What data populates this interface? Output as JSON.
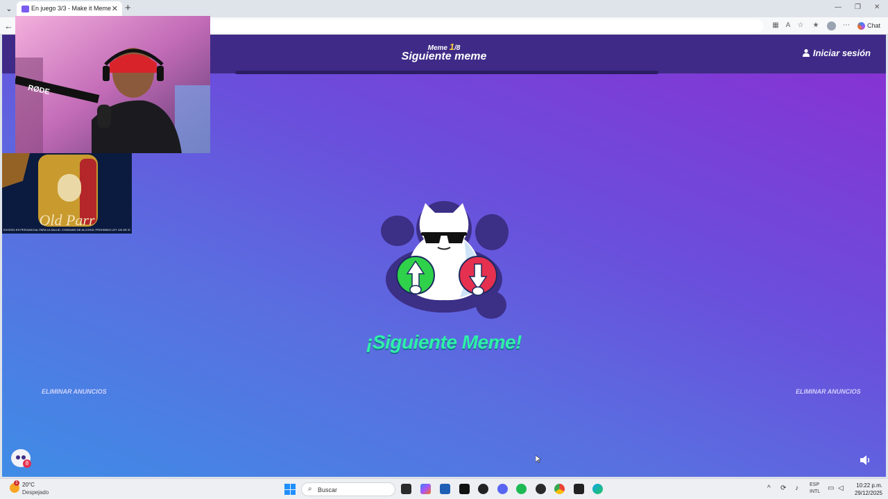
{
  "browser": {
    "tab_title": "En juego 3/3 - Make it Meme",
    "chat_label": "Chat"
  },
  "game": {
    "counter_prefix": "Meme ",
    "counter_current": "1",
    "counter_total": "/8",
    "header_title": "Siguiente meme",
    "login_label": "Iniciar sesión",
    "next_meme_text": "¡Siguiente Meme!",
    "remove_ads_left": "ELIMINAR ANUNCIOS",
    "remove_ads_right": "ELIMINAR ANUNCIOS",
    "chat_badge": "8",
    "colors": {
      "header": "#3f2b87",
      "accent_green": "#2ff0a8",
      "counter_yellow": "#ffd23a",
      "upvote": "#2fd14a",
      "downvote": "#e5304f"
    }
  },
  "overlays": {
    "webcam_mic_brand": "RØDE",
    "ad_brand": "Old Parr",
    "ad_legal": "EXCESO ES PERJUDICIAL PARA LA SALUD. CONSUMO DE ALCOHOL PROHIBIDO LEY 124 DE 2009 WWW.DIAGEO.COM"
  },
  "taskbar": {
    "weather_temp": "20°C",
    "weather_desc": "Despejado",
    "weather_badge": "1",
    "search_placeholder": "Buscar",
    "lang_top": "ESP",
    "lang_bottom": "INTL",
    "time": "10:22 p.m.",
    "date": "29/12/2025"
  }
}
